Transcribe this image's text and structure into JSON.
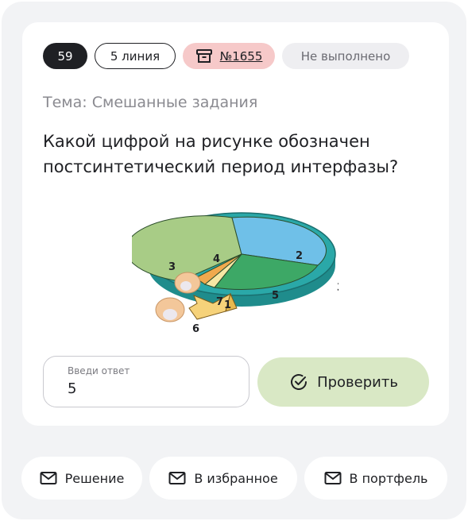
{
  "tags": {
    "number": "59",
    "line": "5 линия",
    "task_id": "№1655",
    "status": "Не выполнено"
  },
  "topic": "Тема: Смешанные задания",
  "question": "Какой цифрой на рисунке обозначен постсинтетический период интерфазы?",
  "figure_labels": [
    "1",
    "2",
    "3",
    "3",
    "4",
    "5",
    "6",
    "7"
  ],
  "answer": {
    "label": "Введи ответ",
    "value": "5"
  },
  "check_button": "Проверить",
  "bottom_buttons": {
    "solution": "Решение",
    "favorites": "В избранное",
    "portfolio": "В портфель"
  },
  "colors": {
    "dark": "#1f2024",
    "task_tag": "#f6c9c9",
    "check_button": "#d9e8c5",
    "ring": "#2aa8a8",
    "sector_2": "#6fc0e8",
    "sector_4": "#a8cc86",
    "sector_5": "#3da866",
    "sector_7": "#f0a94e"
  }
}
